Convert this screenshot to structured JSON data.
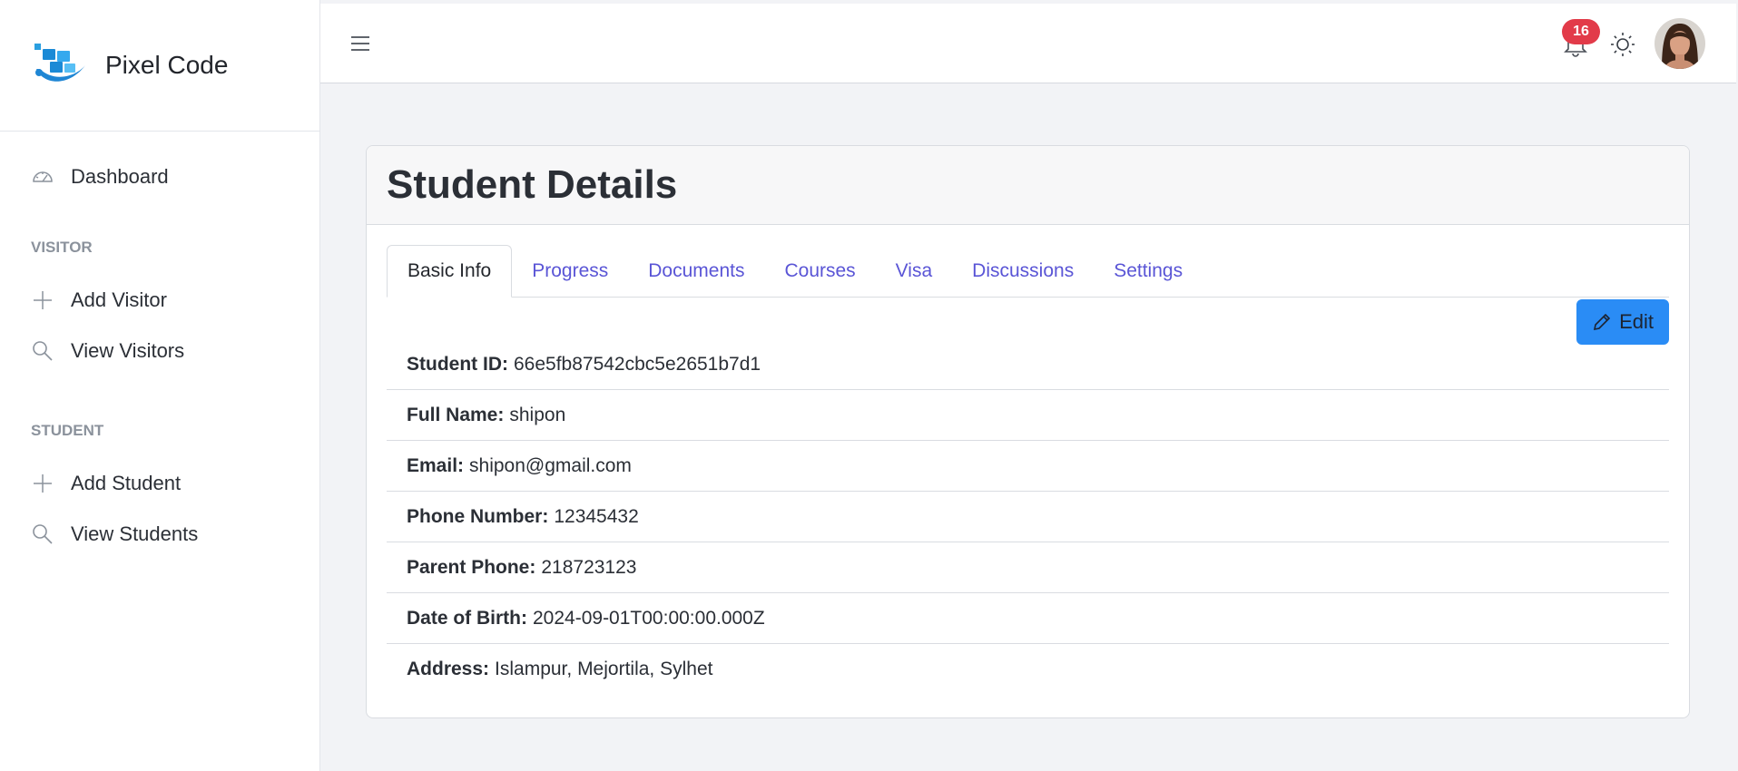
{
  "brand": {
    "name": "Pixel Code"
  },
  "sidebar": {
    "dashboard": {
      "label": "Dashboard",
      "icon": "speedometer-icon"
    },
    "sections": [
      {
        "title": "VISITOR",
        "items": [
          {
            "label": "Add Visitor",
            "icon": "plus-icon"
          },
          {
            "label": "View Visitors",
            "icon": "search-icon"
          }
        ]
      },
      {
        "title": "STUDENT",
        "items": [
          {
            "label": "Add Student",
            "icon": "plus-icon"
          },
          {
            "label": "View Students",
            "icon": "search-icon"
          }
        ]
      }
    ]
  },
  "topbar": {
    "notification_count": "16",
    "menu_icon": "hamburger-icon",
    "bell_icon": "bell-icon",
    "theme_icon": "sun-icon"
  },
  "card": {
    "title": "Student Details",
    "tabs": [
      {
        "label": "Basic Info",
        "active": true
      },
      {
        "label": "Progress"
      },
      {
        "label": "Documents"
      },
      {
        "label": "Courses"
      },
      {
        "label": "Visa"
      },
      {
        "label": "Discussions"
      },
      {
        "label": "Settings"
      }
    ],
    "edit_label": "Edit",
    "fields": [
      {
        "label": "Student ID:",
        "value": "66e5fb87542cbc5e2651b7d1"
      },
      {
        "label": "Full Name:",
        "value": "shipon"
      },
      {
        "label": "Email:",
        "value": "shipon@gmail.com"
      },
      {
        "label": "Phone Number:",
        "value": "12345432"
      },
      {
        "label": "Parent Phone:",
        "value": "218723123"
      },
      {
        "label": "Date of Birth:",
        "value": "2024-09-01T00:00:00.000Z"
      },
      {
        "label": "Address:",
        "value": "Islampur, Mejortila, Sylhet"
      }
    ]
  },
  "colors": {
    "accent": "#5a55d6",
    "primary_button": "#2a8cf5",
    "badge": "#e23b49",
    "background": "#f2f3f6"
  }
}
